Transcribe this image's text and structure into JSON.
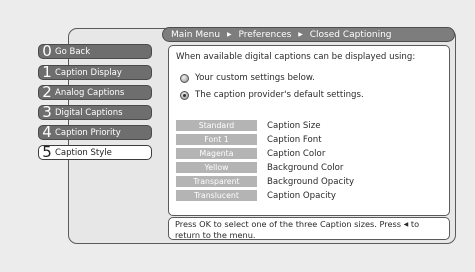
{
  "breadcrumb": {
    "items": [
      "Main Menu",
      "Preferences",
      "Closed Captioning"
    ],
    "separator": "▶"
  },
  "menu": {
    "items": [
      {
        "number": "0",
        "label": "Go Back",
        "selected": false
      },
      {
        "number": "1",
        "label": "Caption Display",
        "selected": false
      },
      {
        "number": "2",
        "label": "Analog Captions",
        "selected": false
      },
      {
        "number": "3",
        "label": "Digital Captions",
        "selected": false
      },
      {
        "number": "4",
        "label": "Caption Priority",
        "selected": false
      },
      {
        "number": "5",
        "label": "Caption Style",
        "selected": true
      }
    ]
  },
  "content": {
    "heading": "When available digital captions can be displayed using:",
    "options": [
      {
        "label": "Your custom settings below.",
        "selected": false
      },
      {
        "label": "The caption provider's default settings.",
        "selected": true
      }
    ],
    "settings": [
      {
        "value": "Standard",
        "name": "Caption Size"
      },
      {
        "value": "Font 1",
        "name": "Caption Font"
      },
      {
        "value": "Magenta",
        "name": "Caption Color"
      },
      {
        "value": "Yellow",
        "name": "Background Color"
      },
      {
        "value": "Transparent",
        "name": "Background Opacity"
      },
      {
        "value": "Translucent",
        "name": "Caption Opacity"
      }
    ]
  },
  "help": {
    "line1_before_arrow": "Press OK to select one of the three Caption sizes. Press",
    "arrow": "◀",
    "line1_after_arrow": "to",
    "line2": "return to the menu."
  },
  "colors": {
    "background": "#ececec",
    "menu_item": "#6e6e6e",
    "menu_item_selected": "#ffffff",
    "breadcrumb": "#7d7d7d",
    "setting_value": "#b4b4b4"
  }
}
